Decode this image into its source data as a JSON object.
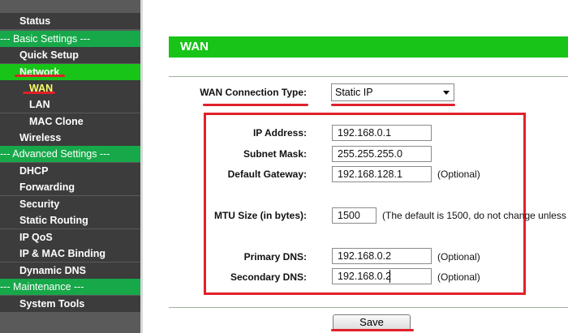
{
  "sidebar": {
    "items": [
      {
        "label": "Status"
      },
      {
        "label": "--- Basic Settings ---"
      },
      {
        "label": "Quick Setup"
      },
      {
        "label": "Network"
      },
      {
        "label": "WAN"
      },
      {
        "label": "LAN"
      },
      {
        "label": "MAC Clone"
      },
      {
        "label": "Wireless"
      },
      {
        "label": "--- Advanced Settings ---"
      },
      {
        "label": "DHCP"
      },
      {
        "label": "Forwarding"
      },
      {
        "label": "Security"
      },
      {
        "label": "Static Routing"
      },
      {
        "label": "IP QoS"
      },
      {
        "label": "IP & MAC Binding"
      },
      {
        "label": "Dynamic DNS"
      },
      {
        "label": "--- Maintenance ---"
      },
      {
        "label": "System Tools"
      }
    ]
  },
  "header": {
    "title": "WAN"
  },
  "wan": {
    "connection_type_label": "WAN Connection Type:",
    "connection_type_value": "Static IP"
  },
  "form": {
    "ip_label": "IP Address:",
    "ip_value": "192.168.0.1",
    "mask_label": "Subnet Mask:",
    "mask_value": "255.255.255.0",
    "gateway_label": "Default Gateway:",
    "gateway_value": "192.168.128.1",
    "gateway_note": "(Optional)",
    "mtu_label": "MTU Size (in bytes):",
    "mtu_value": "1500",
    "mtu_note": "(The default is 1500, do not change unless",
    "dns1_label": "Primary DNS:",
    "dns1_value": "192.168.0.2",
    "dns1_note": "(Optional)",
    "dns2_label": "Secondary DNS:",
    "dns2_value": "192.168.0.2",
    "dns2_note": "(Optional)"
  },
  "actions": {
    "save_label": "Save"
  },
  "colors": {
    "accent_green": "#17c417",
    "sidebar_bg": "#3c3c3c",
    "annotation_red": "#e0202a"
  }
}
